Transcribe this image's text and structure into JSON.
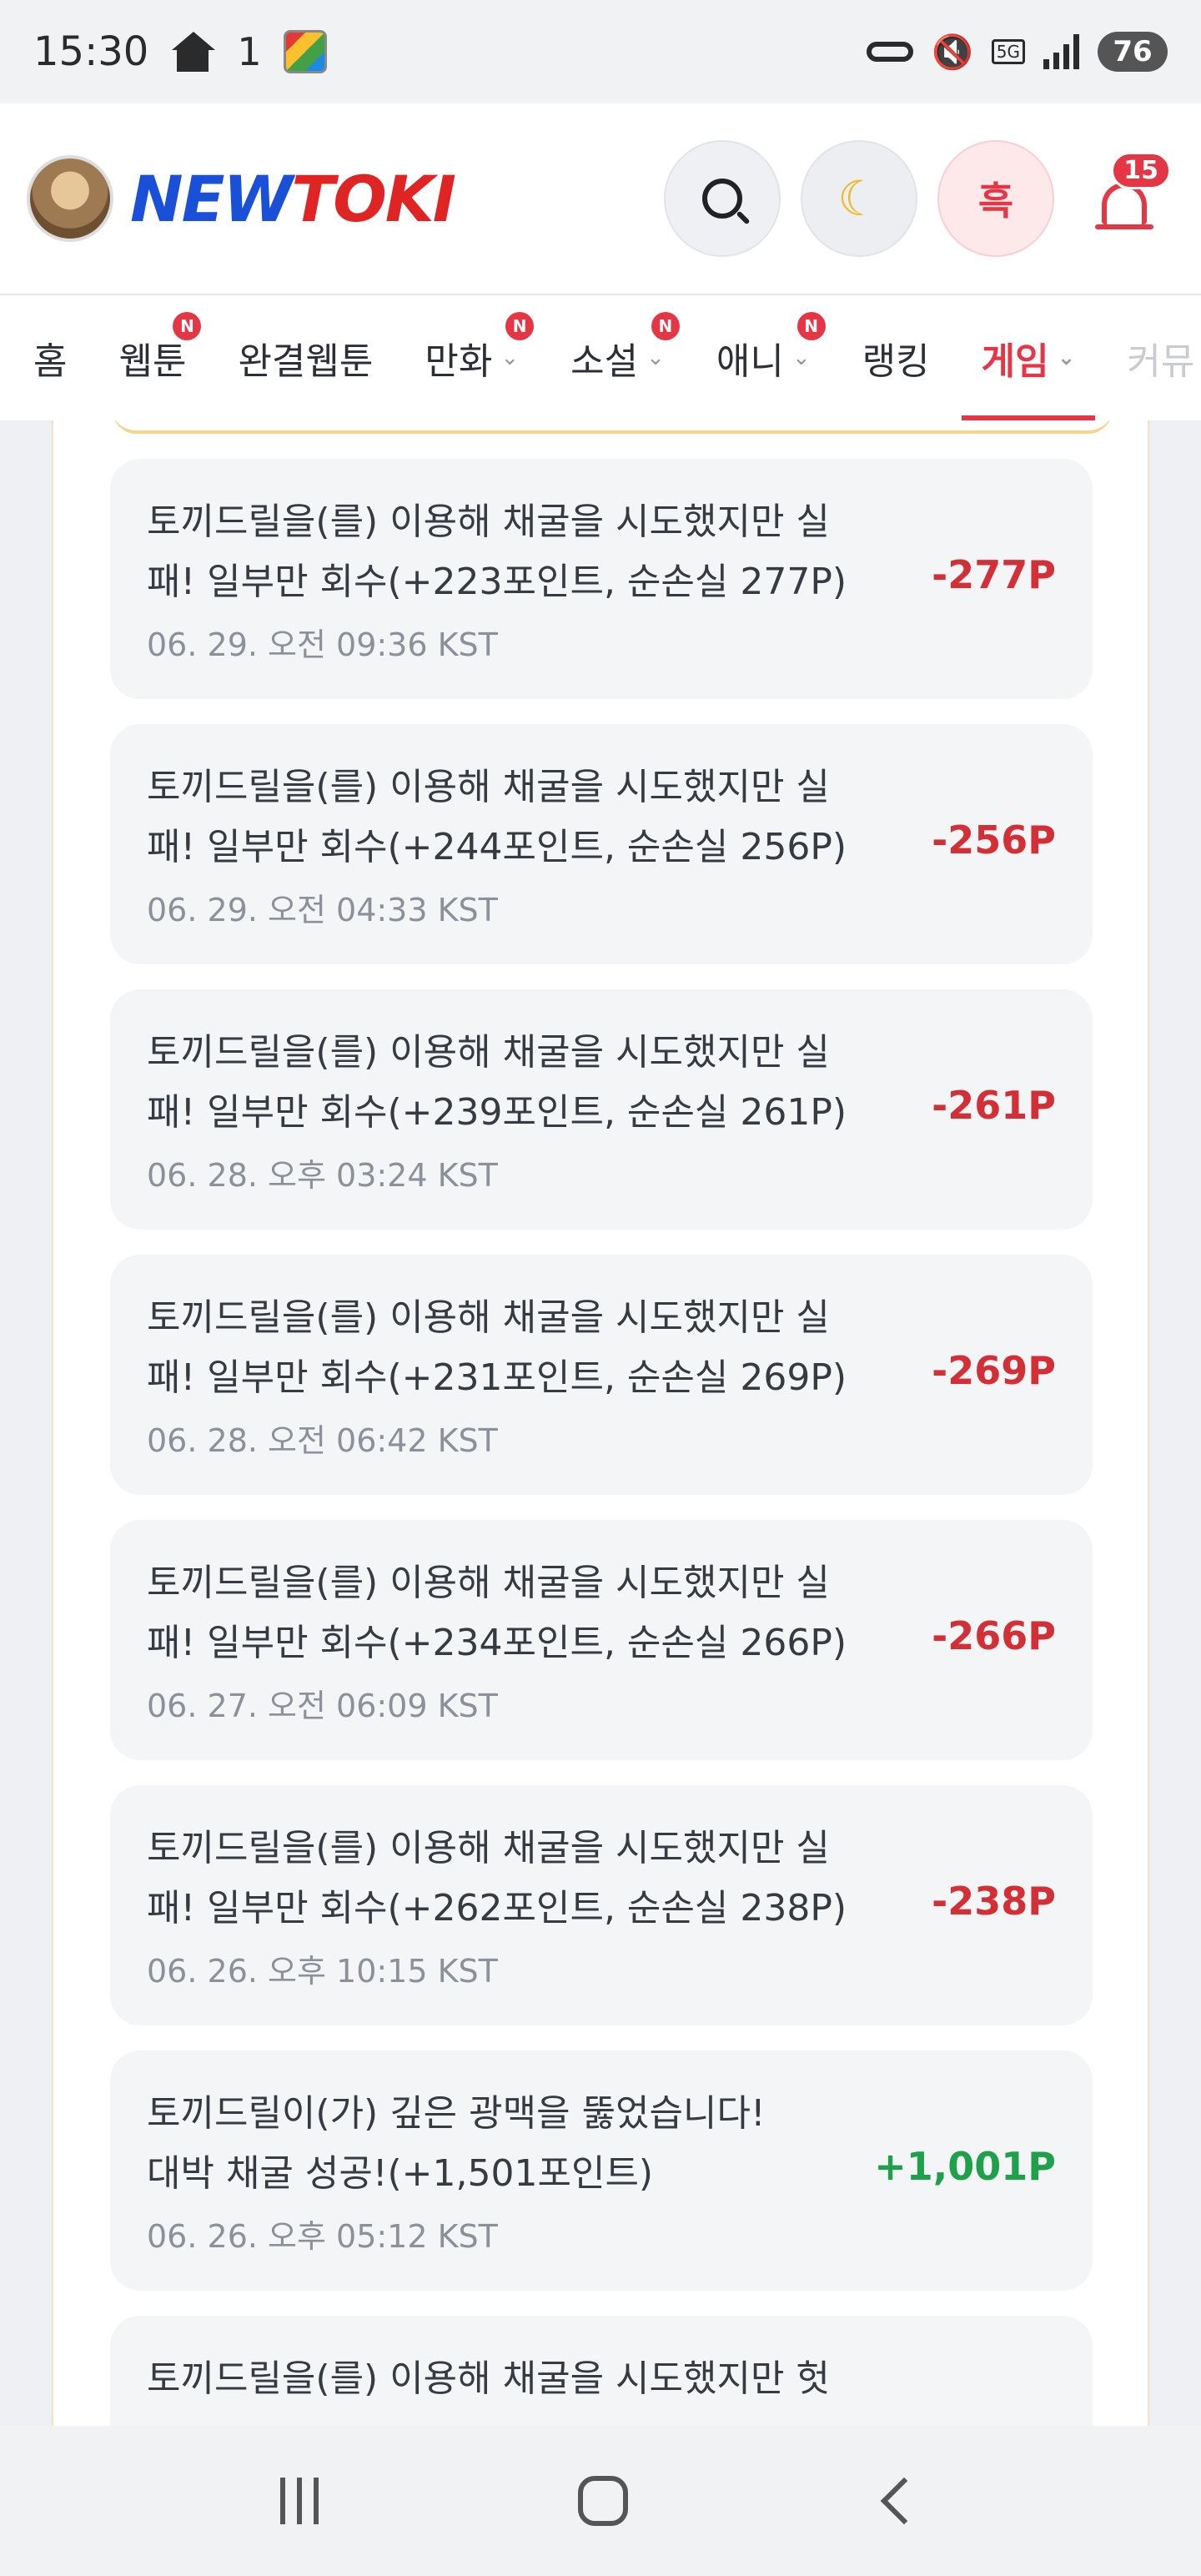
{
  "status_bar": {
    "time": "15:30",
    "one": "1",
    "battery": "76",
    "network": "5G"
  },
  "header": {
    "logo_new": "NEW",
    "logo_toki": "TOKI",
    "theme_label": "흑",
    "notification_count": "15"
  },
  "tabs": [
    {
      "label": "홈"
    },
    {
      "label": "웹툰",
      "badge": "N"
    },
    {
      "label": "완결웹툰"
    },
    {
      "label": "만화",
      "badge": "N",
      "chevron": "⌄"
    },
    {
      "label": "소설",
      "badge": "N",
      "chevron": "⌄"
    },
    {
      "label": "애니",
      "badge": "N",
      "chevron": "⌄"
    },
    {
      "label": "랭킹"
    },
    {
      "label": "게임",
      "chevron": "⌄"
    },
    {
      "label": "커뮤"
    }
  ],
  "entries": [
    {
      "line1": "토끼드릴을(를) 이용해 채굴을 시도했지만 실",
      "line2": "패! 일부만 회수(+223포인트, 순손실 277P)",
      "time": "06. 29. 오전 09:36 KST",
      "amount": "-277P"
    },
    {
      "line1": "토끼드릴을(를) 이용해 채굴을 시도했지만 실",
      "line2": "패! 일부만 회수(+244포인트, 순손실 256P)",
      "time": "06. 29. 오전 04:33 KST",
      "amount": "-256P"
    },
    {
      "line1": "토끼드릴을(를) 이용해 채굴을 시도했지만 실",
      "line2": "패! 일부만 회수(+239포인트, 순손실 261P)",
      "time": "06. 28. 오후 03:24 KST",
      "amount": "-261P"
    },
    {
      "line1": "토끼드릴을(를) 이용해 채굴을 시도했지만 실",
      "line2": "패! 일부만 회수(+231포인트, 순손실 269P)",
      "time": "06. 28. 오전 06:42 KST",
      "amount": "-269P"
    },
    {
      "line1": "토끼드릴을(를) 이용해 채굴을 시도했지만 실",
      "line2": "패! 일부만 회수(+234포인트, 순손실 266P)",
      "time": "06. 27. 오전 06:09 KST",
      "amount": "-266P"
    },
    {
      "line1": "토끼드릴을(를) 이용해 채굴을 시도했지만 실",
      "line2": "패! 일부만 회수(+262포인트, 순손실 238P)",
      "time": "06. 26. 오후 10:15 KST",
      "amount": "-238P"
    },
    {
      "line1": "토끼드릴이(가) 깊은 광맥을 뚫었습니다!",
      "line2": "대박 채굴 성공!(+1,501포인트)",
      "time": "06. 26. 오후 05:12 KST",
      "amount": "+1,001P"
    },
    {
      "line1": "토끼드릴을(를) 이용해 채굴을 시도했지만 헛",
      "line2": "",
      "time": "",
      "amount": ""
    }
  ]
}
